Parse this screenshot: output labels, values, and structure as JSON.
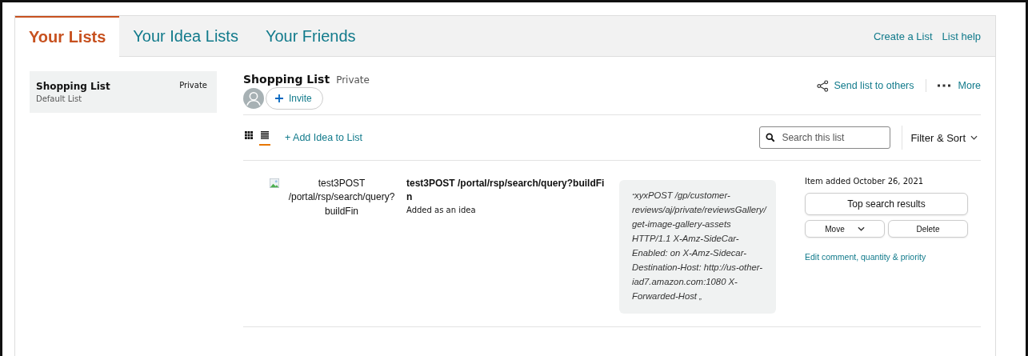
{
  "tabs": [
    {
      "label": "Your Lists",
      "selected": true
    },
    {
      "label": "Your Idea Lists",
      "selected": false
    },
    {
      "label": "Your Friends",
      "selected": false
    }
  ],
  "header_links": [
    "Create a List",
    "List help"
  ],
  "sidebar": {
    "items": [
      {
        "name": "Shopping List",
        "privacy": "Private",
        "subtitle": "Default List",
        "selected": true
      }
    ]
  },
  "list": {
    "title": "Shopping List",
    "privacy": "Private",
    "invite": "Invite",
    "send": "Send list to others",
    "more": "More",
    "view_modes": [
      {
        "kind": "grid",
        "selected": false
      },
      {
        "kind": "list",
        "selected": true
      }
    ],
    "add_idea": "+ Add Idea to List",
    "search": {
      "placeholder": "Search this list"
    },
    "filter_sort": "Filter & Sort"
  },
  "items": [
    {
      "image_alt": "test3POST /portal/rsp/search/query?buildFin",
      "title": "test3POST /portal/rsp/search/query?buildFin",
      "subtitle": "Added as an idea",
      "open_quote": "“",
      "comment": "xyxPOST /gp/customer-reviews/aj/private/reviewsGallery/get-image-gallery-assets HTTP/1.1 X-Amz-SideCar-Enabled: on X-Amz-Sidecar-Destination-Host: http://us-other-iad7.amazon.com:1080 X-Forwarded-Host",
      "close_quote": "„",
      "added": "Item added October 26, 2021",
      "primary_button": "Top search results",
      "move": "Move",
      "delete": "Delete",
      "edit_link": "Edit comment, quantity & priority"
    }
  ]
}
